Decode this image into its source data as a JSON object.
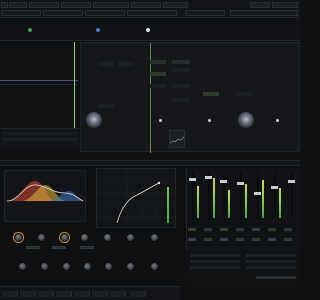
{
  "app": {
    "toolbar_time": "00:00:00:00",
    "toolbar_tabs": [
      "",
      "",
      "",
      "",
      "",
      "",
      "",
      ""
    ]
  },
  "colors": {
    "accent_green": "#3fa64a",
    "accent_yellow": "#d0b04a",
    "eq_red": "#d34b3b",
    "eq_yellow": "#e1b93b",
    "eq_blue": "#3f79c8",
    "knob_ring": "#d09a2a",
    "playhead": "#8bd36a"
  },
  "eq": {
    "icon": "eq-curve-icon"
  },
  "meters": {
    "levels": [
      0.72,
      0.85,
      0.6,
      0.9,
      0.55,
      0.7,
      0.8,
      0.65,
      0.5,
      0.75
    ]
  },
  "icons": [
    "gear-icon",
    "play-icon",
    "record-icon",
    "knob-icon",
    "fader-icon"
  ]
}
